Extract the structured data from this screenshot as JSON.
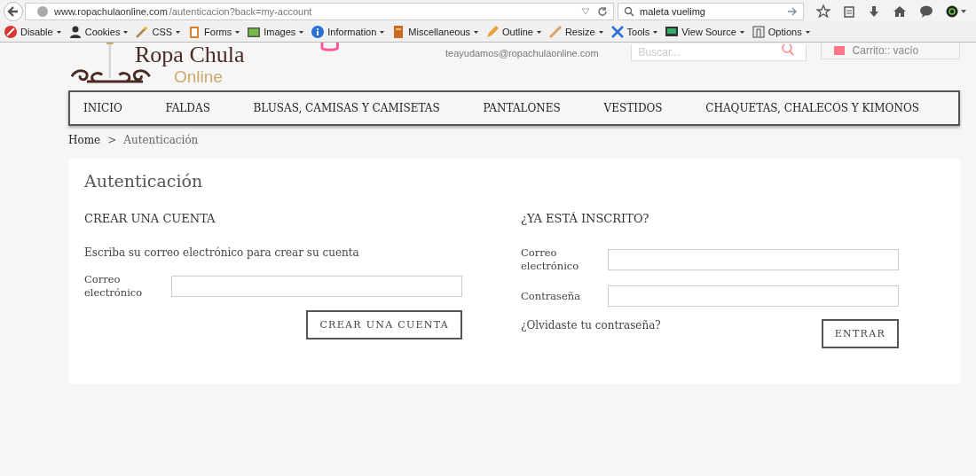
{
  "browser": {
    "url_host": "www.ropachulaonline.com",
    "url_path": "/autenticacion?back=my-account",
    "search_value": "maleta vuelimg"
  },
  "devtoolbar": [
    "Disable",
    "Cookies",
    "CSS",
    "Forms",
    "Images",
    "Information",
    "Miscellaneous",
    "Outline",
    "Resize",
    "Tools",
    "View Source",
    "Options"
  ],
  "header": {
    "logo_title": "Ropa Chula",
    "logo_sub": "Online",
    "email": "teayudamos@ropachulaonline.com",
    "search_placeholder": "Buscar...",
    "cart": "Carrito:: vacío"
  },
  "nav": [
    "INICIO",
    "FALDAS",
    "BLUSAS, CAMISAS Y CAMISETAS",
    "PANTALONES",
    "VESTIDOS",
    "CHAQUETAS, CHALECOS Y KIMONOS"
  ],
  "breadcrumb": [
    "Home",
    ">",
    "Autenticación"
  ],
  "page_title": "Autenticación",
  "create": {
    "heading": "CREAR UNA CUENTA",
    "text": "Escriba su correo electrónico para crear su cuenta",
    "email_label": "Correo electrónico",
    "button": "CREAR UNA CUENTA"
  },
  "login": {
    "heading": "¿YA ESTÁ INSCRITO?",
    "email_label": "Correo electrónico",
    "password_label": "Contraseña",
    "forgot": "¿Olvidaste tu contraseña?",
    "button": "ENTRAR"
  }
}
